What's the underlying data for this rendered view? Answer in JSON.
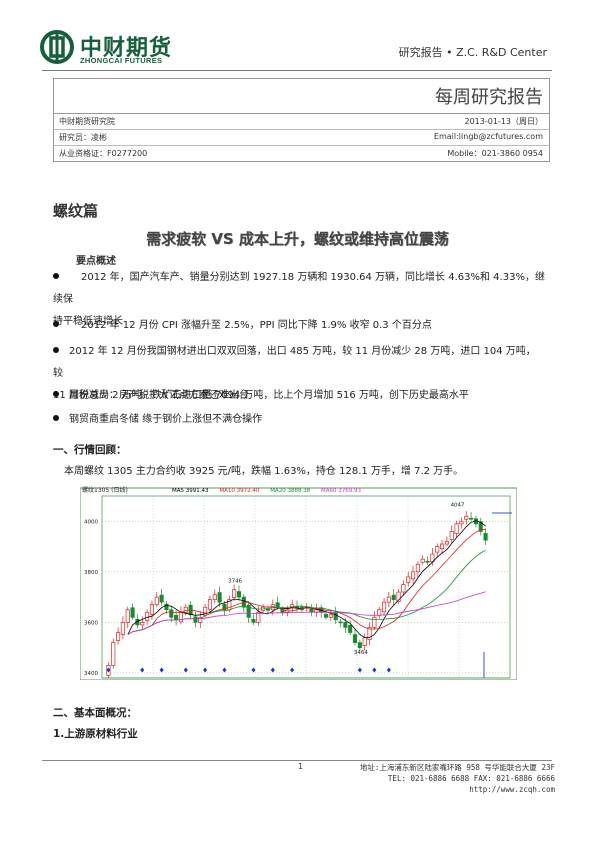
{
  "header": {
    "logo_cn": "中财期货",
    "logo_en": "ZHONGCAI FUTURES",
    "right_text": "研究报告 • Z.C. R&D Center"
  },
  "info": {
    "report_title": "每周研究报告",
    "rows": [
      {
        "left": "中财期货研究院",
        "right": "2013-01-13（周日）"
      },
      {
        "left": "研究员：凌彬",
        "right": "Email:lingb@zcfutures.com"
      },
      {
        "left": "从业资格证：F0277200",
        "right": "Mobile：021-3860 0954"
      }
    ]
  },
  "section_title": "螺纹篇",
  "headline": "需求疲软 VS 成本上升，螺纹或维持高位震荡",
  "key_points_label": "要点概述",
  "bullets": [
    {
      "line1": "2012 年，国产汽车产、销量分别达到 1927.18 万辆和 1930.64 万辆，同比增长 4.63%和 4.33%，继续保",
      "line2": "持平稳低速增长"
    },
    {
      "line1": "2012 年 12 月份 CPI 涨幅升至 2.5%，PPI 同比下降 1.9% 收窄 0.3 个百分点",
      "line2": ""
    },
    {
      "line1": "2012 年 12 月份我国钢材进出口双双回落，出口 485 万吨，较 11 月份减少 28 万吨，进口 104 万吨，较",
      "line2": "11 月份减少 2 万吨。铁矿石进口量 7094 万吨，比上个月增加 516 万吨，创下历史最高水平"
    },
    {
      "line1": "国税总局：房产税扩大试点方案还难出台",
      "line2": ""
    },
    {
      "line1": "钢贸商重启冬储 缘于钢价上涨但不满仓操作",
      "line2": ""
    }
  ],
  "section1": {
    "title": "一、行情回顾：",
    "text": "本周螺纹 1305 主力合约收 3925 元/吨，跌幅 1.63%，持仓 128.1 万手，增 7.2 万手。"
  },
  "chart_data": {
    "type": "candlestick",
    "title": "螺纹1305 (日线)",
    "legend": [
      {
        "name": "MA5 3991.43",
        "color": "#000000"
      },
      {
        "name": "MA10 3972.40",
        "color": "#e0201e"
      },
      {
        "name": "MA20 3888.38",
        "color": "#1b8a2e"
      },
      {
        "name": "MA60 3769.93",
        "color": "#c933c9"
      }
    ],
    "ylim": [
      3380,
      4100
    ],
    "yticks": [
      "4000",
      "3800",
      "3600",
      "3400"
    ],
    "annotations": [
      {
        "label": "3746",
        "index": 26,
        "value": 3746
      },
      {
        "label": "3464",
        "index": 52,
        "value": 3464
      },
      {
        "label": "4047",
        "index": 72,
        "value": 4047
      }
    ],
    "closes": [
      3430,
      3520,
      3560,
      3600,
      3650,
      3620,
      3590,
      3600,
      3640,
      3670,
      3700,
      3680,
      3650,
      3620,
      3610,
      3640,
      3660,
      3630,
      3600,
      3620,
      3660,
      3690,
      3710,
      3680,
      3650,
      3690,
      3730,
      3700,
      3660,
      3620,
      3600,
      3640,
      3660,
      3650,
      3670,
      3660,
      3640,
      3650,
      3670,
      3660,
      3650,
      3660,
      3640,
      3650,
      3640,
      3620,
      3630,
      3610,
      3600,
      3580,
      3560,
      3520,
      3500,
      3540,
      3580,
      3620,
      3650,
      3680,
      3700,
      3690,
      3720,
      3750,
      3780,
      3800,
      3830,
      3850,
      3840,
      3870,
      3900,
      3910,
      3920,
      3960,
      3990,
      4000,
      4020,
      4010,
      3990,
      3960,
      3925
    ],
    "colors": {
      "up": "#e0201e",
      "down": "#1b8a2e",
      "ma5": "#000000",
      "ma10": "#e0201e",
      "ma20": "#1b8a2e",
      "ma60": "#c933c9",
      "grid": "#9ac59a",
      "frame": "#5a9a5a"
    }
  },
  "section2": {
    "title": "二、基本面概况：",
    "sub": "1.上游原材料行业"
  },
  "footer": {
    "page": "1",
    "addr": "地址:上海浦东新区陆家嘴环路 958 号华能联合大厦 23F",
    "tel": "TEL: 021-6886 6688 FAX: 021-6886 6666",
    "web": "http://www.zcqh.com"
  }
}
